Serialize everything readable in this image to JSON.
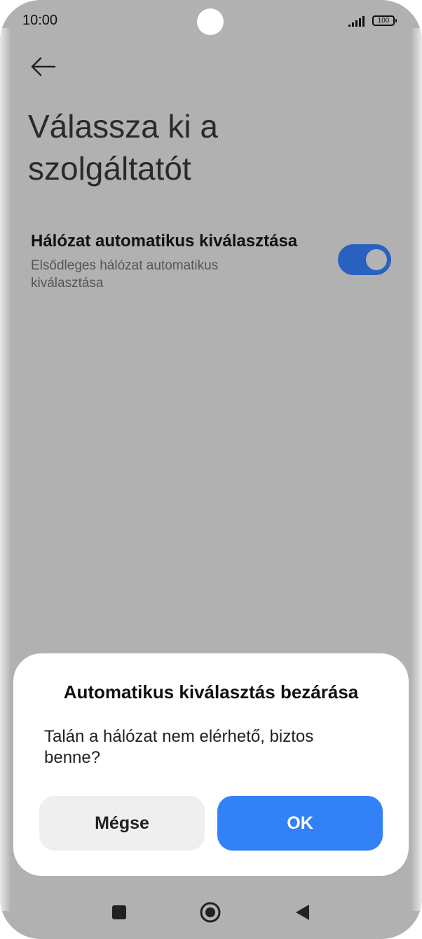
{
  "status_bar": {
    "time": "10:00",
    "battery_level": "100",
    "icons": [
      "signal-icon",
      "battery-icon"
    ]
  },
  "header": {
    "back_icon": "back-arrow-icon",
    "title": "Válassza ki a szolgáltatót"
  },
  "setting": {
    "title": "Hálózat automatikus kiválasztása",
    "subtitle": "Elsődleges hálózat automatikus kiválasztása",
    "toggle_state": "on",
    "toggle_color": "#2a61c0"
  },
  "dialog": {
    "title": "Automatikus kiválasztás bezárása",
    "message": "Talán a hálózat nem elérhető, biztos benne?",
    "cancel_label": "Mégse",
    "ok_label": "OK",
    "ok_color": "#3381f7"
  },
  "nav_bar": {
    "icons": [
      "recents-icon",
      "home-icon",
      "back-icon"
    ]
  }
}
